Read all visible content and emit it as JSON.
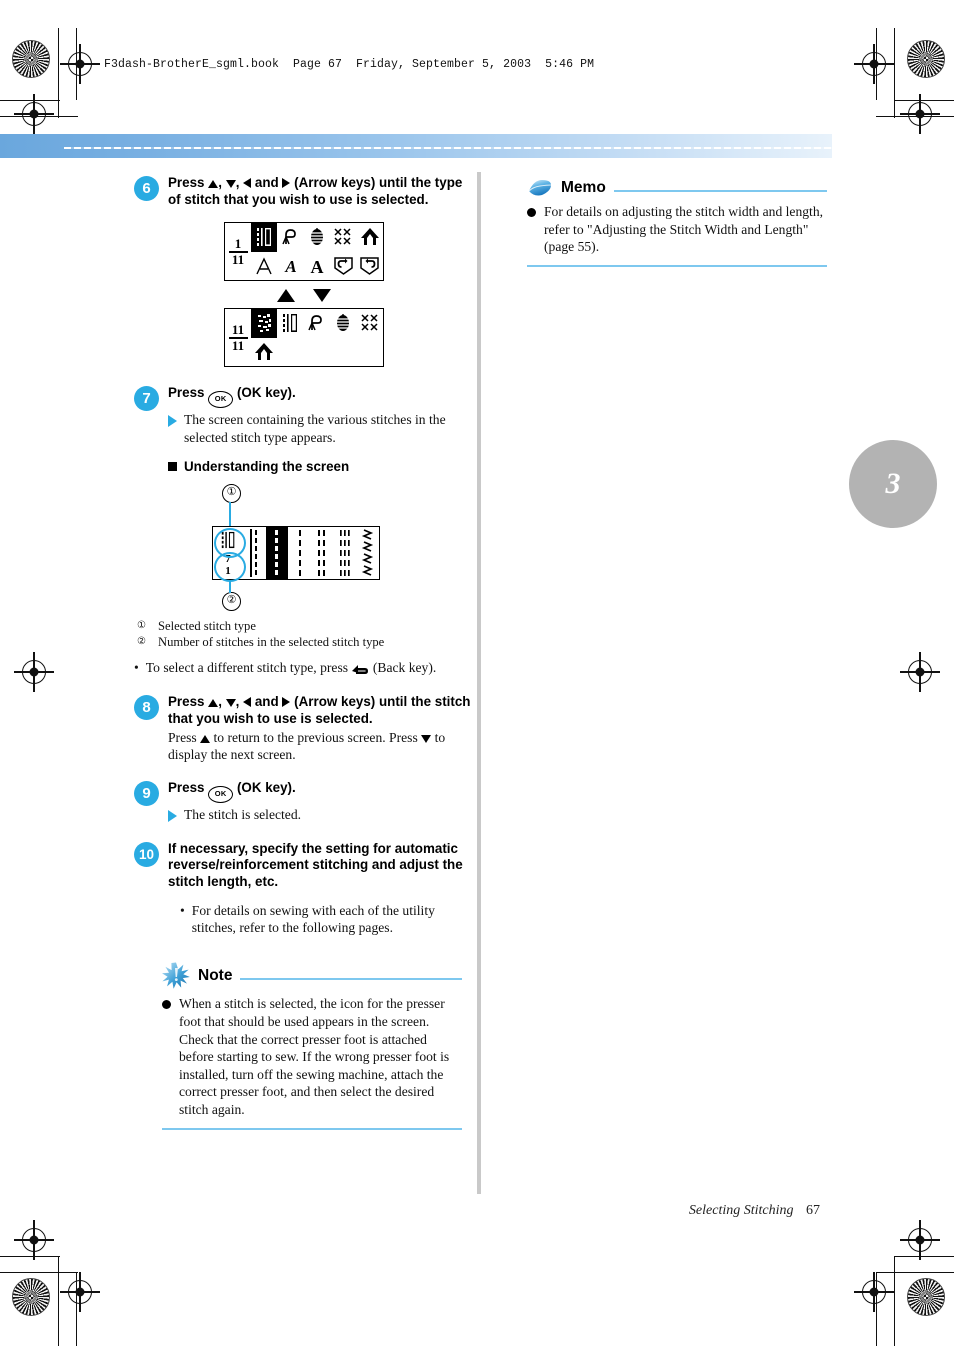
{
  "running_head": "F3dash-BrotherE_sgml.book  Page 67  Friday, September 5, 2003  5:46 PM",
  "chapter_tab": "3",
  "footer": {
    "section": "Selecting Stitching",
    "page": "67"
  },
  "colors": {
    "accent_blue": "#29abe2",
    "rule_blue": "#7ec8ef",
    "band_blue": "#6aa7dd",
    "tab_gray": "#b3b3b3"
  },
  "steps": [
    {
      "number": "6",
      "title_parts": {
        "lead": "Press",
        "after_arrows": "(Arrow keys) until the type of stitch that you wish to use is selected.",
        "and": "and",
        "comma": ","
      }
    },
    {
      "number": "7",
      "title_lead": "Press",
      "title_tail": "(OK key).",
      "result": "The screen containing the various stitches in the selected stitch type appears."
    },
    {
      "number": "8",
      "title_lead": "Press",
      "title_tail": "(Arrow keys) until the stitch that you wish to use is selected.",
      "sub_a": "Press",
      "sub_b": "to return to the previous screen. Press",
      "sub_c": "to display the next screen."
    },
    {
      "number": "9",
      "title_lead": "Press",
      "title_tail": "(OK key).",
      "result": "The stitch is selected."
    },
    {
      "number": "10",
      "title": "If necessary, specify the setting for automatic reverse/reinforcement stitching and adjust the stitch length, etc.",
      "bullet": "For details on sewing with each of the utility stitches, refer to the following pages."
    }
  ],
  "subheading": "Understanding the screen",
  "lcd_screen_1": {
    "page_current": "1",
    "page_total": "11",
    "selected_index": 0,
    "icons": [
      "straight-stitch-icon",
      "overcasting-stitch-icon",
      "blind-hem-stitch-icon",
      "cross-stitch-icon",
      "buttonhole-icon",
      "letter-block-a-icon",
      "letter-script-a-icon",
      "letter-serif-a-icon",
      "pocket-left-icon",
      "pocket-right-icon"
    ]
  },
  "lcd_screen_2": {
    "page_current": "11",
    "page_total": "11",
    "selected_index": 0,
    "icons": [
      "decorative-stitch-icon",
      "straight-stitch-icon",
      "overcasting-stitch-icon",
      "blind-hem-stitch-icon",
      "cross-stitch-icon",
      "buttonhole-icon"
    ]
  },
  "figure": {
    "callout_1": "①",
    "callout_2": "②",
    "stitch_type_fraction_top": "7",
    "stitch_type_fraction_bottom": "1"
  },
  "legend": [
    {
      "marker": "①",
      "text": "Selected stitch type"
    },
    {
      "marker": "②",
      "text": "Number of stitches in the selected stitch type"
    }
  ],
  "back_key_bullet": {
    "lead": "To select a different stitch type, press",
    "tail": "(Back key)."
  },
  "note_box": {
    "title": "Note",
    "items": [
      "When a stitch is selected, the icon for the presser foot that should be used appears in the screen. Check that the correct presser foot is attached before starting to sew. If the wrong presser foot is installed, turn off the sewing machine, attach the correct presser foot, and then select the desired stitch again."
    ]
  },
  "memo_box": {
    "title": "Memo",
    "items": [
      "For details on adjusting the stitch width and length, refer to \"Adjusting the Stitch Width and Length\" (page 55)."
    ]
  },
  "icon_names": {
    "ok_key": "ok-key-icon",
    "back_key": "back-key-icon",
    "arrow_up": "arrow-up-icon",
    "arrow_down": "arrow-down-icon",
    "arrow_left": "arrow-left-icon",
    "arrow_right": "arrow-right-icon",
    "memo": "memo-page-icon",
    "note": "note-sparkle-icon"
  },
  "ok_label": "OK"
}
